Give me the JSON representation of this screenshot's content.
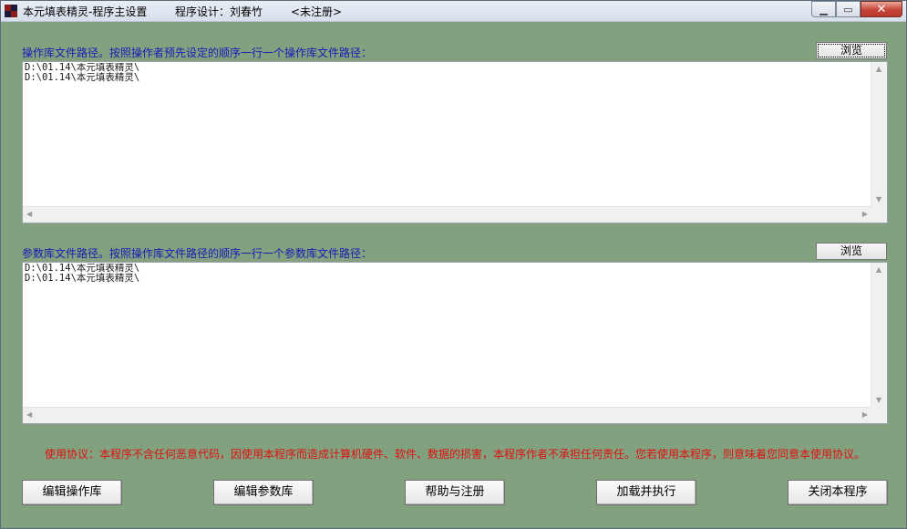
{
  "window": {
    "title": "本元填表精灵-程序主设置",
    "designer": "程序设计：刘春竹",
    "status": "<未注册>"
  },
  "operation_section": {
    "label": "操作库文件路径。按照操作者预先设定的顺序一行一个操作库文件路径：",
    "browse_label": "浏览",
    "content": "D:\\01.14\\本元填表精灵\\\nD:\\01.14\\本元填表精灵\\"
  },
  "parameter_section": {
    "label": "参数库文件路径。按照操作库文件路径的顺序一行一个参数库文件路径：",
    "browse_label": "浏览",
    "content": "D:\\01.14\\本元填表精灵\\\nD:\\01.14\\本元填表精灵\\"
  },
  "notice": "使用协议：本程序不含任何恶意代码，因使用本程序而造成计算机硬件、软件、数据的损害，本程序作者不承担任何责任。您若使用本程序，则意味着您同意本使用协议。",
  "buttons": {
    "edit_operation": "编辑操作库",
    "edit_parameter": "编辑参数库",
    "help_register": "帮助与注册",
    "load_execute": "加载并执行",
    "close_program": "关闭本程序"
  },
  "colors": {
    "background": "#82a17e",
    "label_blue": "#1a1ab8",
    "notice_red": "#e01010"
  },
  "icons": {
    "app": "app-grid-icon",
    "minimize": "minimize-icon",
    "maximize": "maximize-icon",
    "close": "close-icon"
  }
}
